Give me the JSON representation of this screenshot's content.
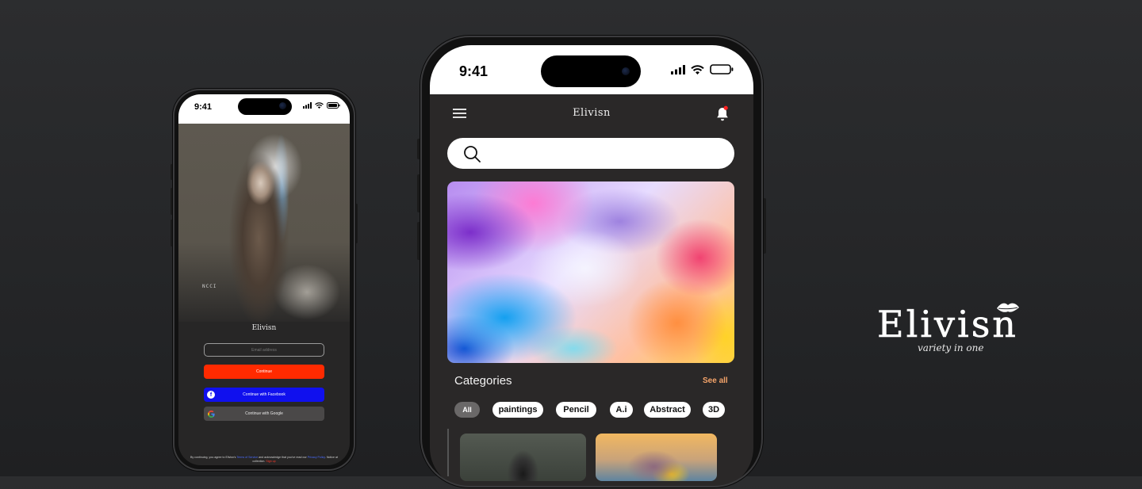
{
  "left_phone": {
    "status": {
      "time": "9:41"
    },
    "art_mark": "NCCI",
    "brand": "Elivisn",
    "email_placeholder": "Email address",
    "continue_label": "Continue",
    "facebook_label": "Continue with Facebook",
    "google_label": "Continue with Google",
    "legal": {
      "prefix": "By continuing, you agree to Elivisn's",
      "terms_link": "Terms of Service",
      "middle": "and acknowledge that you've read our",
      "privacy_link": "Privacy Policy",
      "tail": ". Notice at collection.",
      "signup": "Sign up"
    }
  },
  "right_phone": {
    "status": {
      "time": "9:41"
    },
    "brand": "Elivisn",
    "search": {
      "placeholder": ""
    },
    "categories_title": "Categories",
    "see_all": "See all",
    "chips": [
      {
        "label": "All",
        "active": true
      },
      {
        "label": "paintings",
        "active": false
      },
      {
        "label": "Pencil",
        "active": false
      },
      {
        "label": "A.i",
        "active": false
      },
      {
        "label": "Abstract",
        "active": false
      },
      {
        "label": "3D",
        "active": false
      }
    ],
    "icons": [
      "menu-icon",
      "bell-icon",
      "search-icon",
      "signal-icon",
      "wifi-icon",
      "battery-icon"
    ]
  },
  "logo": {
    "word": "Elivisn",
    "tagline": "variety in one"
  },
  "colors": {
    "background": "#252628",
    "continue": "#ff2a00",
    "facebook": "#1010ee",
    "google_btn": "#4a4848",
    "see_all": "#f5a46a",
    "notification_dot": "#ff2020"
  }
}
